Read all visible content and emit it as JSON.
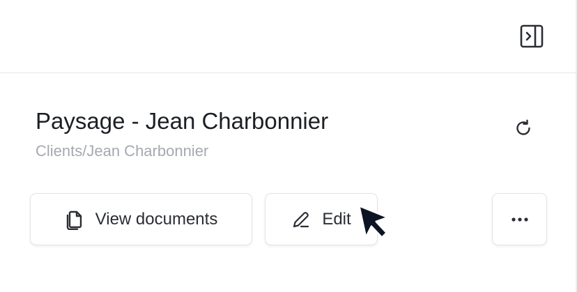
{
  "header": {
    "collapse_icon": "sidebar-collapse-icon"
  },
  "record": {
    "title": "Paysage - Jean Charbonnier",
    "path": "Clients/Jean Charbonnier",
    "refresh_icon": "refresh-icon"
  },
  "actions": {
    "view_documents_label": "View documents",
    "view_documents_icon": "documents-icon",
    "edit_label": "Edit",
    "edit_icon": "pencil-icon",
    "more_label": "···",
    "more_icon": "more-horizontal-icon"
  },
  "colors": {
    "text_primary": "#1c1f24",
    "text_muted": "#a5a9b0",
    "border": "#e1e3e7"
  }
}
